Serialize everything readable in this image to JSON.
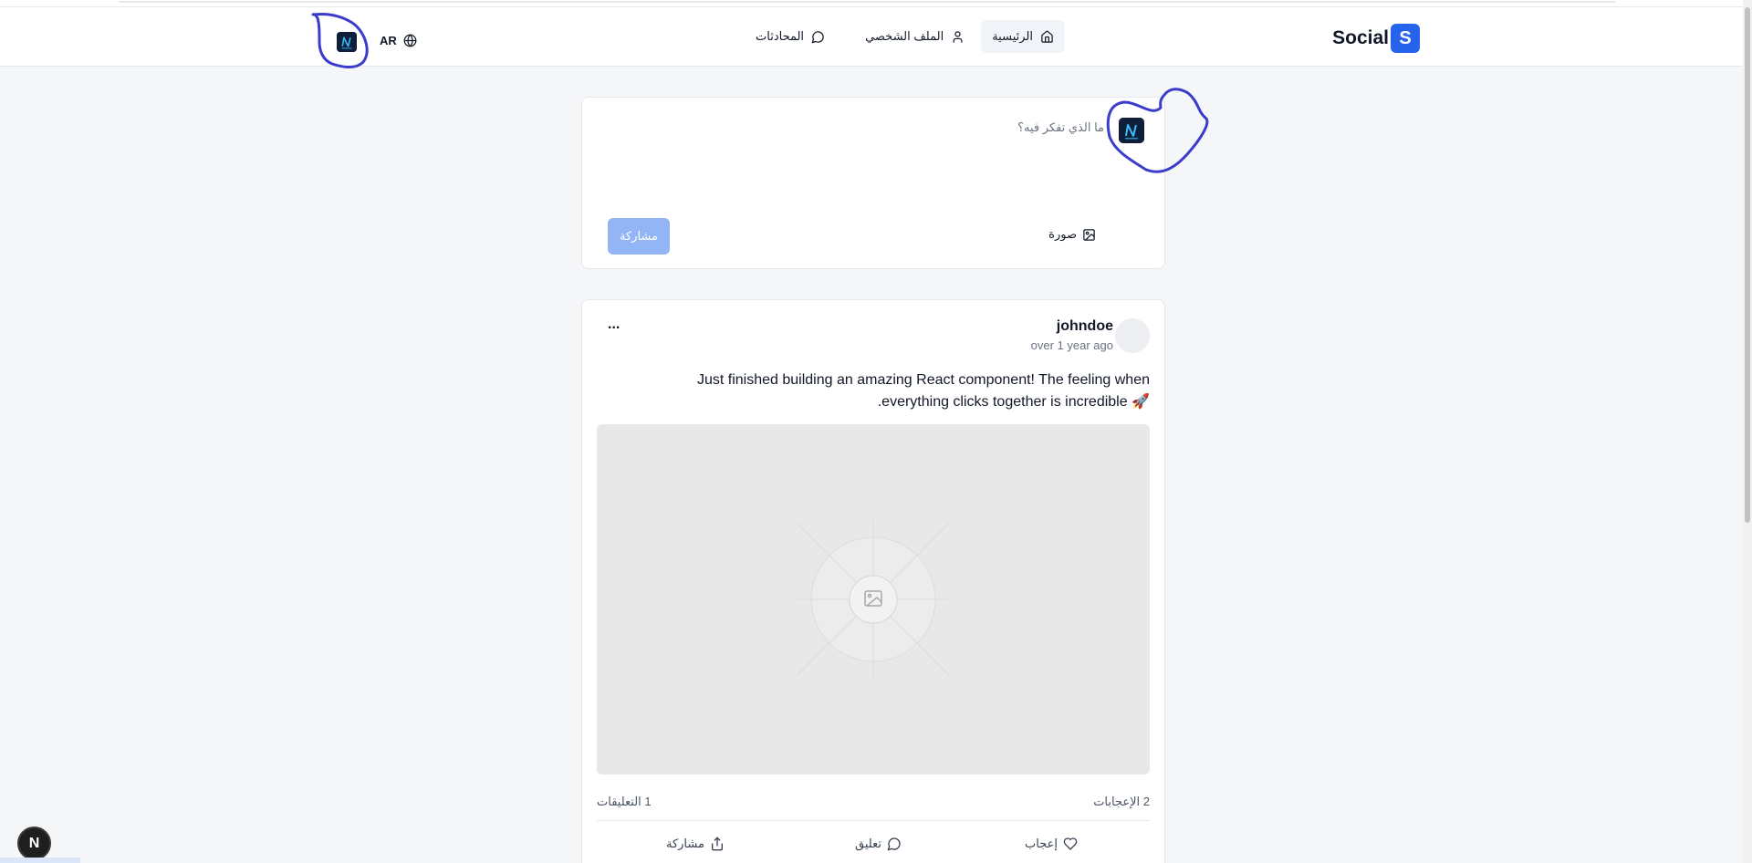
{
  "navbar": {
    "brand_name": "Social",
    "brand_badge": "S",
    "links": {
      "home": "الرئيسية",
      "profile": "الملف الشخصي",
      "chats": "المحادثات"
    },
    "lang_label": "AR"
  },
  "composer": {
    "placeholder": "ما الذي تفكر فيه؟",
    "photo_label": "صورة",
    "share_label": "مشاركة"
  },
  "post": {
    "username": "johndoe",
    "time": "over 1 year ago",
    "more_label": "...",
    "content_line1": "Just finished building an amazing React component! The feeling when",
    "content_line2": ".everything clicks together is incredible 🚀",
    "likes_count": "2 الإعجابات",
    "comments_count": "1 التعليقات",
    "actions": {
      "like": "إعجاب",
      "comment": "تعليق",
      "share": "مشاركة"
    }
  },
  "dev_badge": "N",
  "colors": {
    "accent": "#2563eb",
    "share_disabled": "#93b4f5",
    "annotation": "#3b3bcc"
  },
  "icons": [
    "home-icon",
    "user-icon",
    "chat-icon",
    "globe-icon",
    "image-icon",
    "heart-icon",
    "comment-icon",
    "share-icon"
  ]
}
